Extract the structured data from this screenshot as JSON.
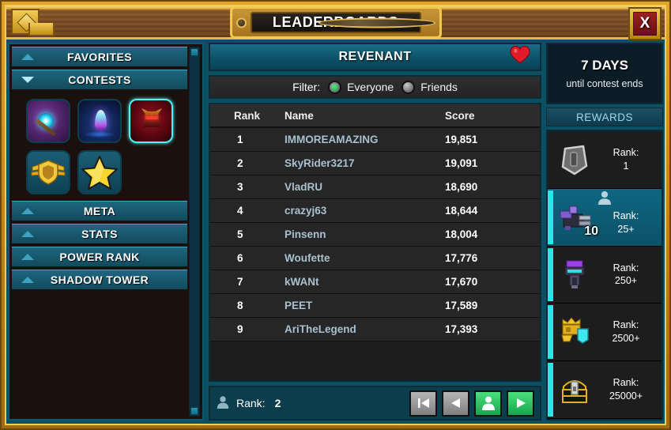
{
  "window": {
    "title": "LEADERBOARDS",
    "close_label": "X",
    "ornament_icon": "gold-diamond-ornament"
  },
  "sidebar": {
    "sections": [
      {
        "label": "FAVORITES",
        "state": "collapsed",
        "arrow_icon": "chevron-up-icon"
      },
      {
        "label": "CONTESTS",
        "state": "expanded",
        "arrow_icon": "chevron-down-icon"
      },
      {
        "label": "META",
        "state": "collapsed",
        "arrow_icon": "chevron-up-icon"
      },
      {
        "label": "STATS",
        "state": "collapsed",
        "arrow_icon": "chevron-up-icon"
      },
      {
        "label": "POWER RANK",
        "state": "collapsed",
        "arrow_icon": "chevron-up-icon"
      },
      {
        "label": "SHADOW TOWER",
        "state": "collapsed",
        "arrow_icon": "chevron-up-icon"
      }
    ],
    "contest_icons": [
      {
        "name": "staff-orb-contest-icon",
        "selected": false
      },
      {
        "name": "soul-flame-contest-icon",
        "selected": false
      },
      {
        "name": "revenant-demon-contest-icon",
        "selected": true
      },
      {
        "name": "winged-shield-badge-icon",
        "selected": false
      },
      {
        "name": "gold-star-badge-icon",
        "selected": false
      }
    ],
    "scrollbar": {
      "up_icon": "scroll-up-handle",
      "down_icon": "scroll-down-handle"
    }
  },
  "board": {
    "title": "REVENANT",
    "favorite_icon": "heart-icon",
    "favorite_color": "#e01b2a",
    "filter": {
      "label": "Filter:",
      "options": [
        {
          "label": "Everyone",
          "selected": true
        },
        {
          "label": "Friends",
          "selected": false
        }
      ],
      "selected_color": "#2fc46a"
    },
    "columns": [
      "Rank",
      "Name",
      "Score"
    ],
    "rows": [
      {
        "rank": "1",
        "name": "IMMOREAMAZING",
        "score": "19,851"
      },
      {
        "rank": "2",
        "name": "SkyRider3217",
        "score": "19,091"
      },
      {
        "rank": "3",
        "name": "VladRU",
        "score": "18,690"
      },
      {
        "rank": "4",
        "name": "crazyj63",
        "score": "18,644"
      },
      {
        "rank": "5",
        "name": "Pinsenn",
        "score": "18,004"
      },
      {
        "rank": "6",
        "name": "Woufette",
        "score": "17,776"
      },
      {
        "rank": "7",
        "name": "kWANt",
        "score": "17,670"
      },
      {
        "rank": "8",
        "name": "PEET",
        "score": "17,589"
      },
      {
        "rank": "9",
        "name": "AriTheLegend",
        "score": "17,393"
      }
    ],
    "footer": {
      "player_icon": "person-icon",
      "rank_label": "Rank:",
      "rank_value": "2",
      "nav": [
        {
          "name": "first-page-button",
          "icon": "skip-back-icon",
          "state": "disabled"
        },
        {
          "name": "previous-page-button",
          "icon": "arrow-left-icon",
          "state": "disabled"
        },
        {
          "name": "my-position-button",
          "icon": "person-icon",
          "state": "enabled"
        },
        {
          "name": "next-page-button",
          "icon": "arrow-right-icon",
          "state": "enabled"
        }
      ]
    }
  },
  "right_panel": {
    "timer": {
      "days": "7 DAYS",
      "subtitle": "until contest ends"
    },
    "rewards_header": "REWARDS",
    "rewards": [
      {
        "icon": "silver-shield-reward-icon",
        "rank_label": "Rank:",
        "rank_value": "1",
        "quantity": "",
        "highlighted": false,
        "tick": false,
        "player_here": false
      },
      {
        "icon": "purple-cannon-reward-icon",
        "rank_label": "Rank:",
        "rank_value": "25+",
        "quantity": "10",
        "highlighted": true,
        "tick": true,
        "player_here": true
      },
      {
        "icon": "purple-armor-reward-icon",
        "rank_label": "Rank:",
        "rank_value": "250+",
        "quantity": "",
        "highlighted": false,
        "tick": true,
        "player_here": false
      },
      {
        "icon": "gold-crown-gem-reward-icon",
        "rank_label": "Rank:",
        "rank_value": "2500+",
        "quantity": "",
        "highlighted": false,
        "tick": true,
        "player_here": false
      },
      {
        "icon": "gold-chest-reward-icon",
        "rank_label": "Rank:",
        "rank_value": "25000+",
        "quantity": "",
        "highlighted": false,
        "tick": true,
        "player_here": false
      }
    ]
  }
}
